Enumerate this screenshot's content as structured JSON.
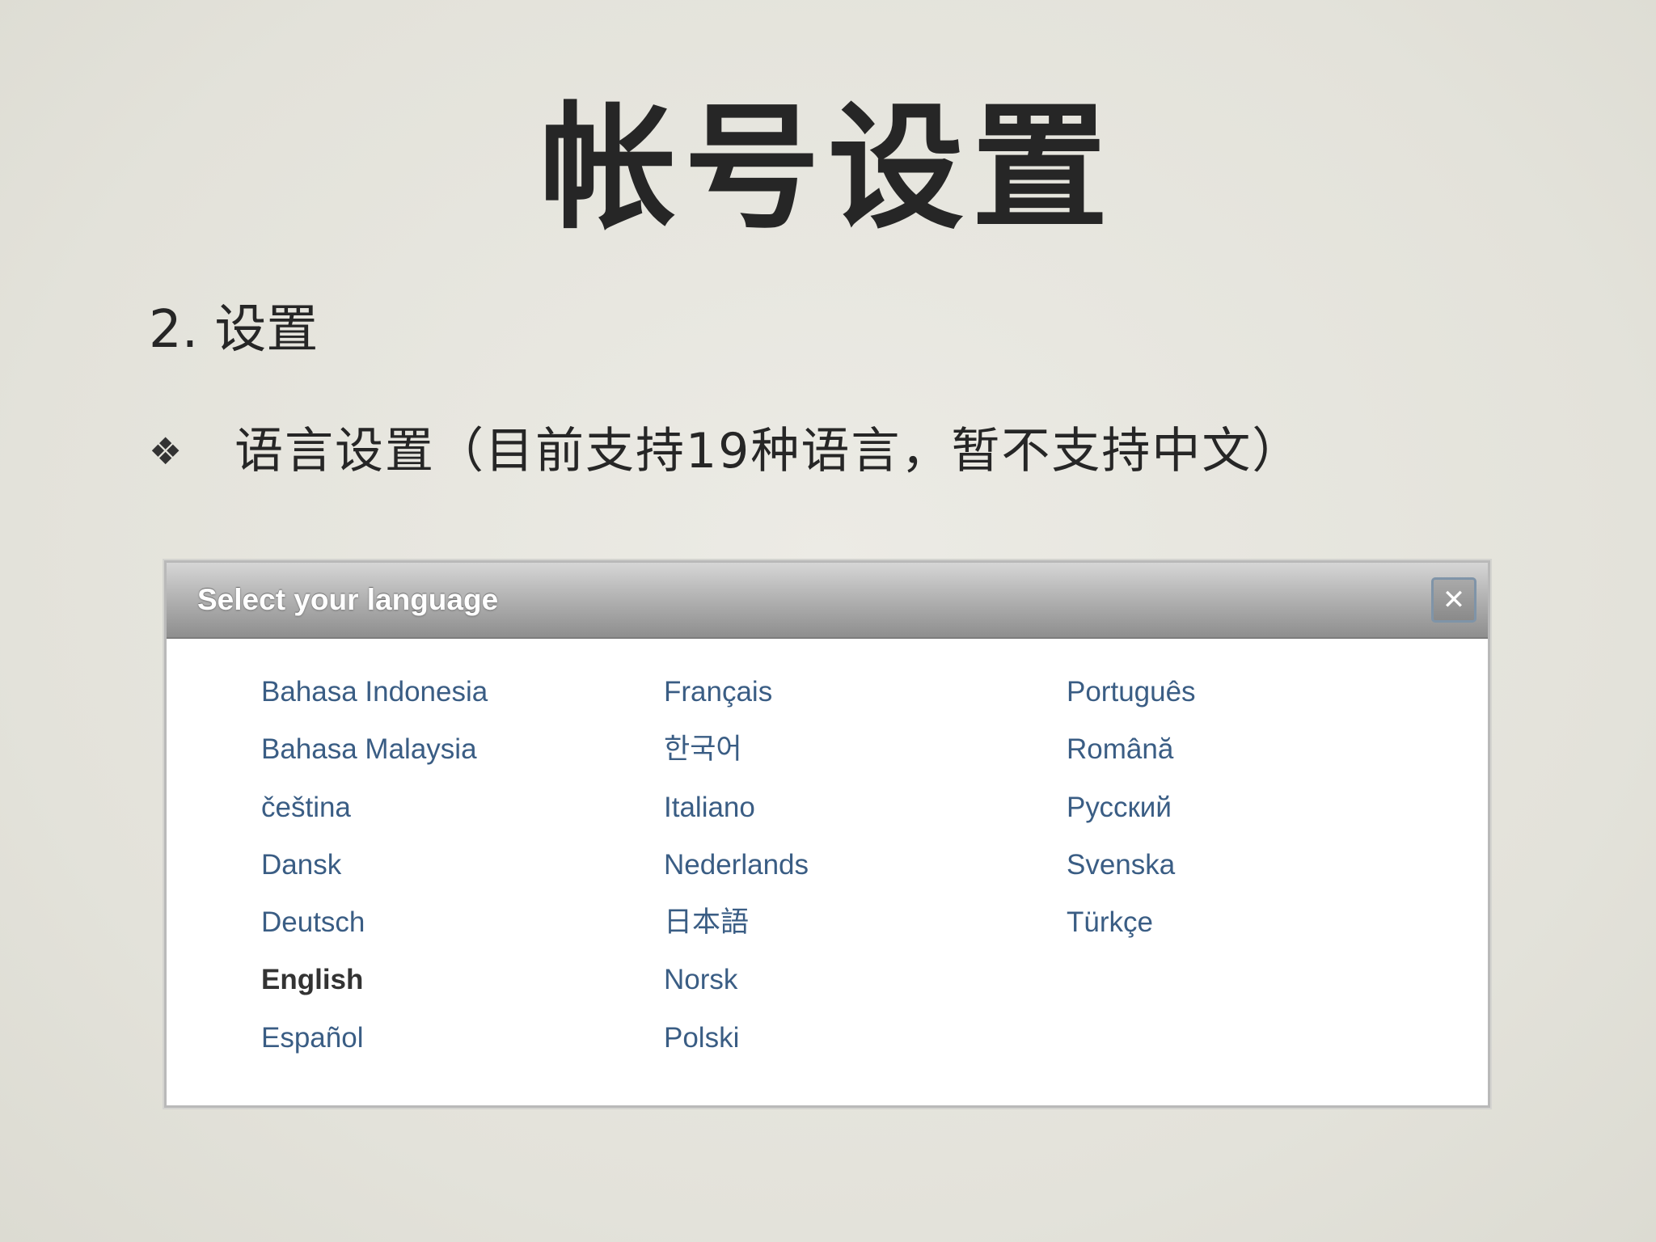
{
  "slide": {
    "title": "帐号设置",
    "section": "2. 设置",
    "bullet_icon": "diamond-cluster-bullet",
    "bullet_glyph": "❖",
    "bullet_text": "语言设置（目前支持19种语言，暂不支持中文）"
  },
  "dialog": {
    "title": "Select your language",
    "close_glyph": "✕",
    "columns": [
      [
        "Bahasa Indonesia",
        "Bahasa Malaysia",
        "čeština",
        "Dansk",
        "Deutsch",
        "English",
        "Español"
      ],
      [
        "Français",
        "한국어",
        "Italiano",
        "Nederlands",
        "日本語",
        "Norsk",
        "Polski"
      ],
      [
        "Português",
        "Română",
        "Русский",
        "Svenska",
        "Türkçe"
      ]
    ],
    "selected": "English",
    "link_color": "#3a5d84",
    "selected_color": "#333333"
  }
}
